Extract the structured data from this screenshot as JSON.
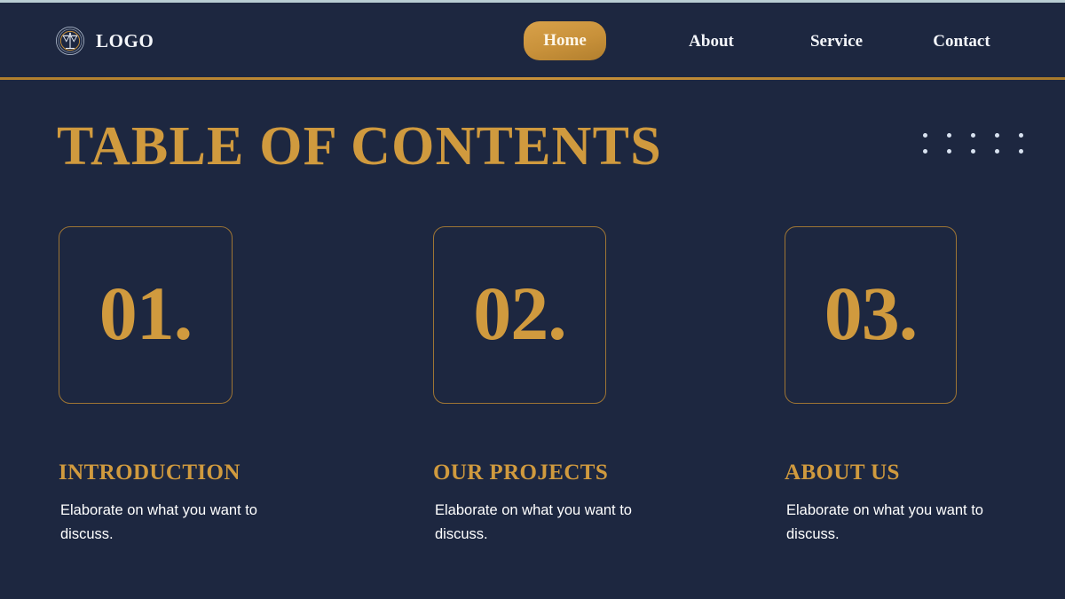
{
  "header": {
    "logo_icon": "scales-of-justice-icon",
    "brand_name": "LOGO",
    "nav_items": [
      {
        "label": "Home",
        "active": true
      },
      {
        "label": "About",
        "active": false
      },
      {
        "label": "Service",
        "active": false
      },
      {
        "label": "Contact",
        "active": false
      }
    ]
  },
  "main": {
    "title": "TABLE OF CONTENTS",
    "decoration": {
      "name": "dot-grid",
      "columns": 5,
      "rows": 2
    },
    "entries": [
      {
        "number": "01.",
        "heading": "INTRODUCTION",
        "body": "Elaborate on what you want to discuss."
      },
      {
        "number": "02.",
        "heading": "OUR PROJECTS",
        "body": "Elaborate on what you want to discuss."
      },
      {
        "number": "03.",
        "heading": "ABOUT US",
        "body": "Elaborate on what you want to discuss."
      }
    ]
  },
  "colors": {
    "background": "#1d2740",
    "gold": "#d09a3e",
    "gold_border": "#9e7534",
    "text_light": "#ffffff",
    "top_hairline": "#b9cdd3"
  }
}
